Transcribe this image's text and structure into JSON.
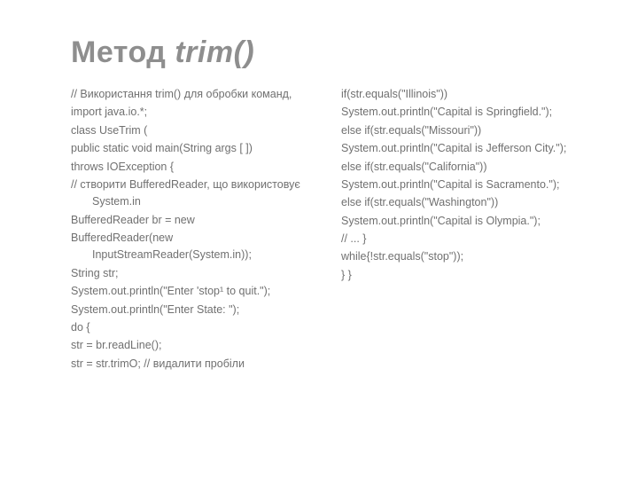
{
  "title_plain": "Метод ",
  "title_italic": "trim()",
  "left": [
    "// Використання trim() для обробки команд,",
    "import java.io.*;",
    "class UseTrim (",
    "public static void main(String args [ ])",
    "throws IOException {",
    "// створити BufferedReader, що використовує System.in",
    "BufferedReader br = new",
    "BufferedReader(new InputStreamReader(System.in));",
    "String str;",
    "System.out.println(\"Enter 'stop¹ to quit.\");",
    " System.out.println(\"Enter State: \");",
    "do {",
    "str = br.readLine();",
    "str = str.trimO;        // видалити пробіли"
  ],
  "right": [
    "if(str.equals(\"Illinois\"))",
    "System.out.println(\"Capital is Springfield.\");",
    "else if(str.equals(\"Missouri\"))",
    "System.out.println(\"Capital is Jefferson City.\");",
    "else if(str.equals(\"California\"))",
    "System.out.println(\"Capital is Sacramento.\");",
    "else if(str.equals(\"Washington\"))",
    "System.out.println(\"Capital is Olympia.\");",
    "// ... }",
    "while{!str.equals(\"stop\"));",
    "} }"
  ]
}
